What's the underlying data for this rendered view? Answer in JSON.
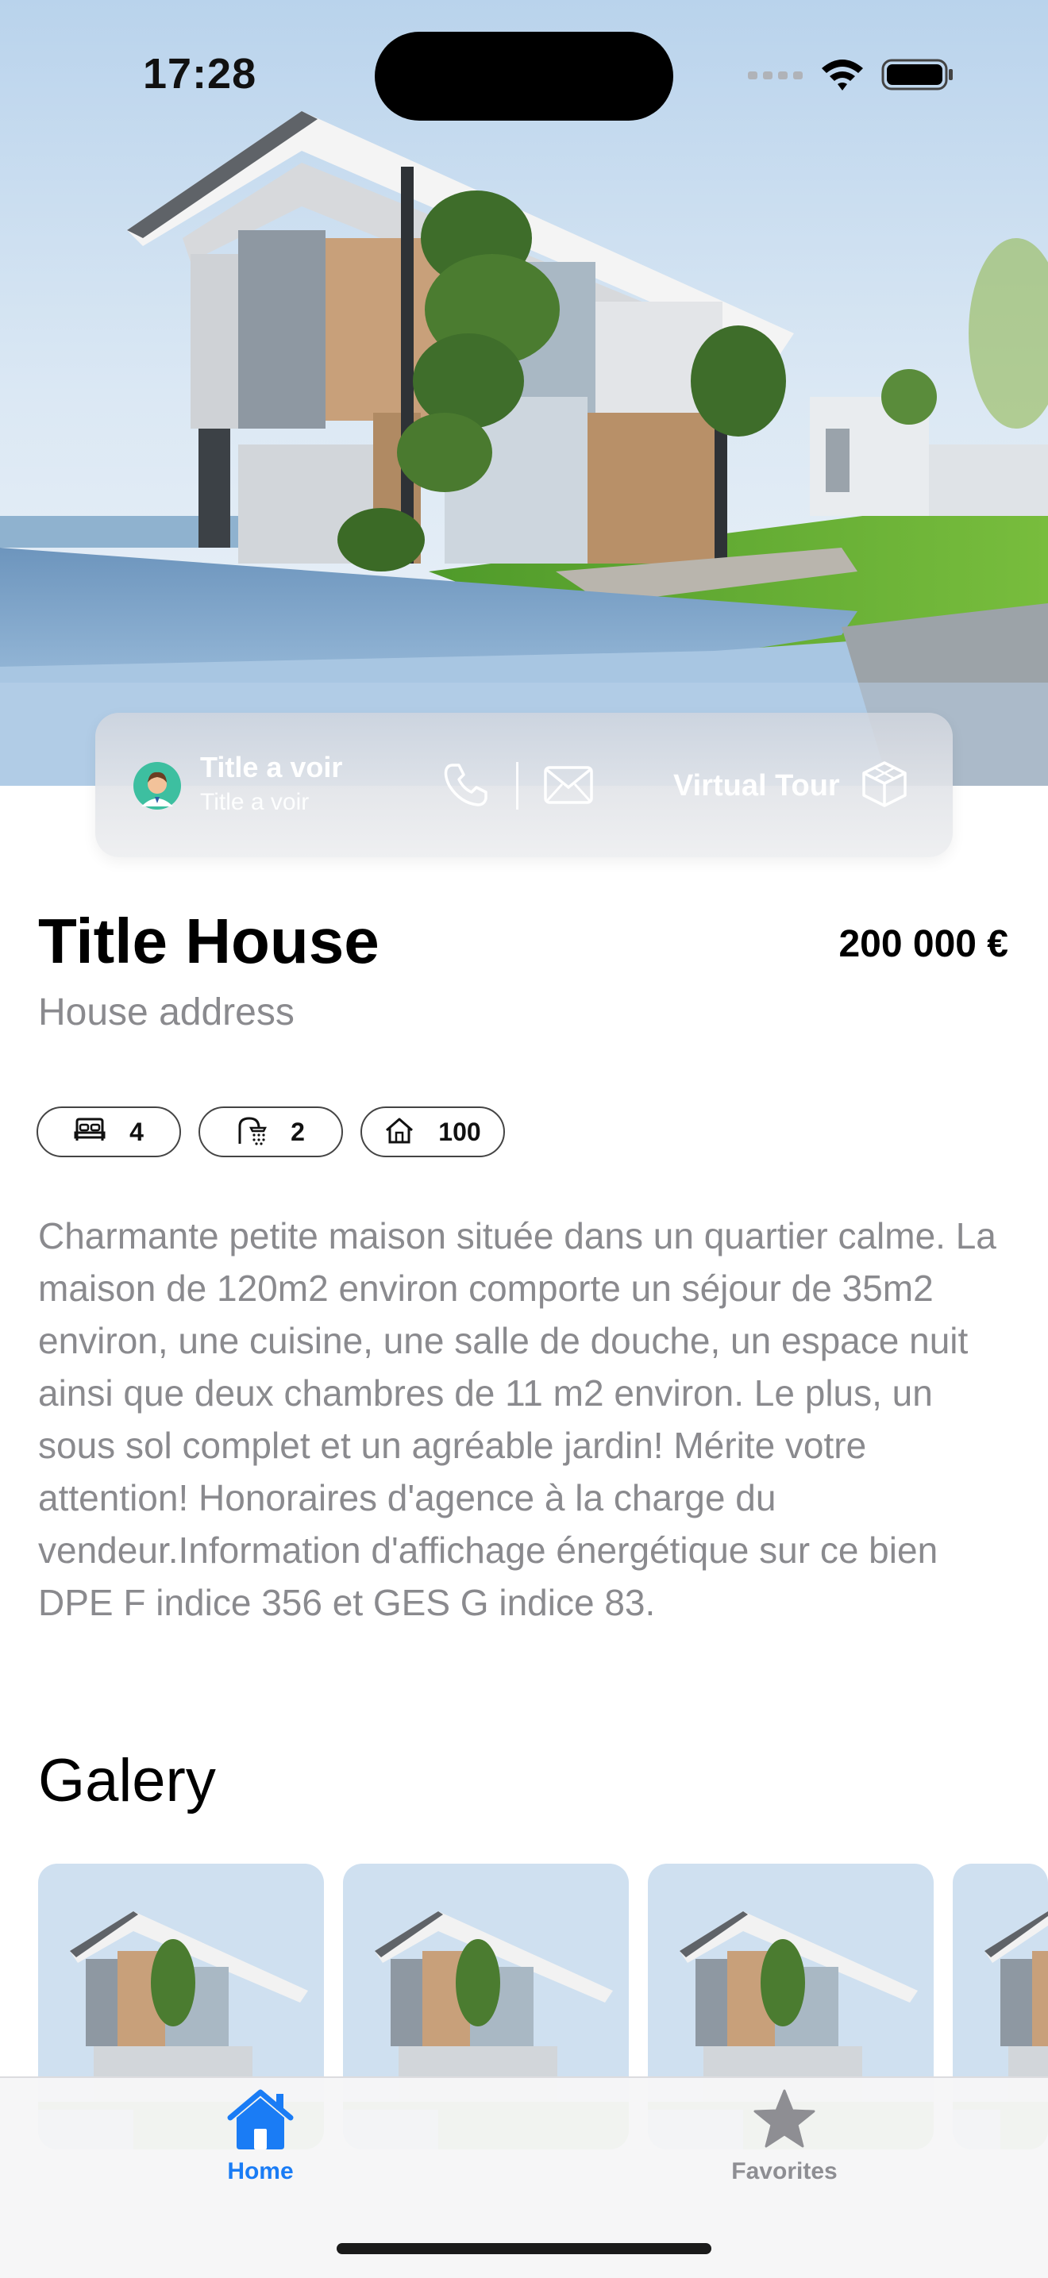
{
  "status_bar": {
    "time": "17:28"
  },
  "agent": {
    "name": "Title a voir",
    "subtitle": "Title a voir",
    "virtual_tour_label": "Virtual Tour"
  },
  "listing": {
    "title": "Title House",
    "price": "200 000 €",
    "address": "House address",
    "features": {
      "bedrooms": "4",
      "bathrooms": "2",
      "surface": "100"
    },
    "description": "Charmante petite maison située dans un quartier calme. La maison de 120m2 environ comporte un séjour de 35m2 environ, une cuisine, une salle de douche, un espace nuit ainsi que deux chambres de 11 m2 environ. Le plus, un sous sol complet et un agréable jardin! Mérite votre attention! Honoraires d'agence à la charge du vendeur.Information d'affichage énergétique sur ce bien DPE F indice 356 et GES G indice 83."
  },
  "gallery": {
    "title": "Galery"
  },
  "tabs": [
    {
      "label": "Home",
      "icon": "house-fill-icon",
      "selected": true
    },
    {
      "label": "Favorites",
      "icon": "star-fill-icon",
      "selected": false
    }
  ],
  "colors": {
    "accent": "#1a7cf5",
    "inactive": "#8e8e93",
    "secondary_text": "#8a8a8e"
  },
  "icons": [
    "bed-icon",
    "shower-icon",
    "house-outline-icon",
    "phone-icon",
    "mail-icon",
    "cube-icon",
    "avatar-icon",
    "wifi-icon",
    "battery-icon",
    "cellular-icon"
  ]
}
